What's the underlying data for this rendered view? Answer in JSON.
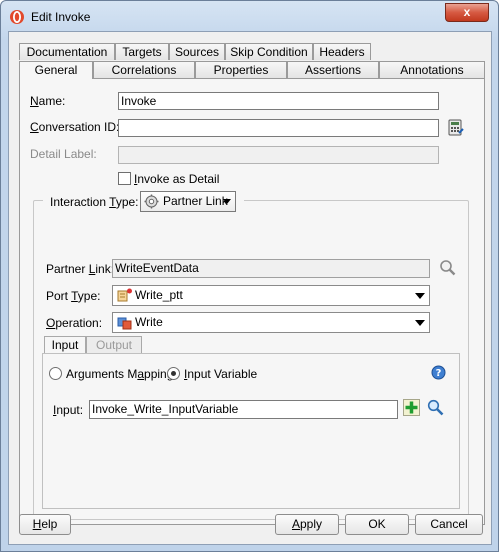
{
  "window": {
    "title": "Edit Invoke",
    "close_glyph": "x"
  },
  "tabs_row1": [
    "Documentation",
    "Targets",
    "Sources",
    "Skip Condition",
    "Headers"
  ],
  "tabs_row2": [
    "General",
    "Correlations",
    "Properties",
    "Assertions",
    "Annotations"
  ],
  "active_tab": "General",
  "form": {
    "name_label_u": "N",
    "name_label_rest": "ame:",
    "name_value": "Invoke",
    "conversation_label_u": "C",
    "conversation_label_rest": "onversation ID:",
    "conversation_value": "",
    "detail_label": "Detail Label:",
    "detail_value": "",
    "invoke_as_detail_u": "I",
    "invoke_as_detail_rest": "nvoke as Detail",
    "invoke_as_detail_checked": false
  },
  "interaction": {
    "legend_pre": "Interaction ",
    "legend_u": "T",
    "legend_post": "ype:",
    "type_value": "Partner Link",
    "partner_link_pre": "Partner ",
    "partner_link_u": "L",
    "partner_link_post": "ink:",
    "partner_link_value": "WriteEventData",
    "port_type_pre": "Port ",
    "port_type_u": "T",
    "port_type_post": "ype:",
    "port_type_value": "Write_ptt",
    "operation_pre": "",
    "operation_u": "O",
    "operation_post": "peration:",
    "operation_value": "Write"
  },
  "io": {
    "tabs": [
      "Input",
      "Output"
    ],
    "active": "Input",
    "radio_args_pre": "Arguments M",
    "radio_args_u": "a",
    "radio_args_post": "pping",
    "radio_var_u": "I",
    "radio_var_rest": "nput Variable",
    "selected_radio": "Input Variable",
    "input_label_u": "I",
    "input_label_rest": "nput:",
    "input_value": "Invoke_Write_InputVariable"
  },
  "buttons": {
    "help_u": "H",
    "help_rest": "elp",
    "apply_u": "A",
    "apply_rest": "pply",
    "ok": "OK",
    "cancel": "Cancel"
  },
  "colors": {
    "accent": "#2f6fb3",
    "window_chrome": "#c3d6ec",
    "close_red": "#d65a42"
  }
}
